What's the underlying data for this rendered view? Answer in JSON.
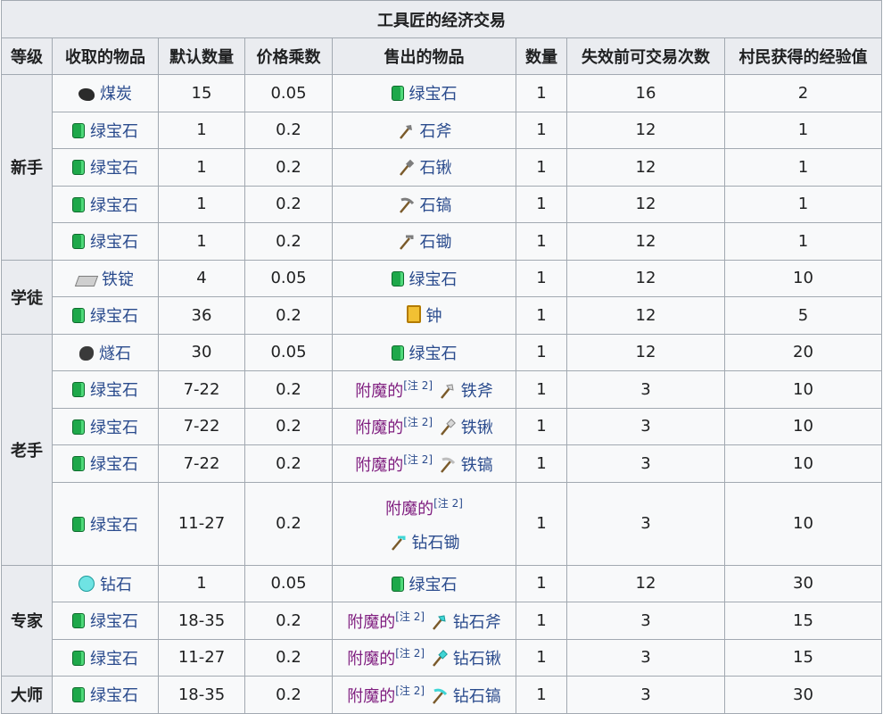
{
  "title": "工具匠的经济交易",
  "headers": [
    "等级",
    "收取的物品",
    "默认数量",
    "价格乘数",
    "售出的物品",
    "数量",
    "失效前可交易次数",
    "村民获得的经验值"
  ],
  "levels": [
    "新手",
    "学徒",
    "老手",
    "专家",
    "大师"
  ],
  "ench_label": "附魔的",
  "note": "[注 2]",
  "rows": [
    {
      "buy": "煤炭",
      "qty": "15",
      "mult": "0.05",
      "sell": "绿宝石",
      "n": "1",
      "uses": "16",
      "xp": "2"
    },
    {
      "buy": "绿宝石",
      "qty": "1",
      "mult": "0.2",
      "sell": "石斧",
      "n": "1",
      "uses": "12",
      "xp": "1"
    },
    {
      "buy": "绿宝石",
      "qty": "1",
      "mult": "0.2",
      "sell": "石锹",
      "n": "1",
      "uses": "12",
      "xp": "1"
    },
    {
      "buy": "绿宝石",
      "qty": "1",
      "mult": "0.2",
      "sell": "石镐",
      "n": "1",
      "uses": "12",
      "xp": "1"
    },
    {
      "buy": "绿宝石",
      "qty": "1",
      "mult": "0.2",
      "sell": "石锄",
      "n": "1",
      "uses": "12",
      "xp": "1"
    },
    {
      "buy": "铁锭",
      "qty": "4",
      "mult": "0.05",
      "sell": "绿宝石",
      "n": "1",
      "uses": "12",
      "xp": "10"
    },
    {
      "buy": "绿宝石",
      "qty": "36",
      "mult": "0.2",
      "sell": "钟",
      "n": "1",
      "uses": "12",
      "xp": "5"
    },
    {
      "buy": "燧石",
      "qty": "30",
      "mult": "0.05",
      "sell": "绿宝石",
      "n": "1",
      "uses": "12",
      "xp": "20"
    },
    {
      "buy": "绿宝石",
      "qty": "7-22",
      "mult": "0.2",
      "sell": "铁斧",
      "n": "1",
      "uses": "3",
      "xp": "10"
    },
    {
      "buy": "绿宝石",
      "qty": "7-22",
      "mult": "0.2",
      "sell": "铁锹",
      "n": "1",
      "uses": "3",
      "xp": "10"
    },
    {
      "buy": "绿宝石",
      "qty": "7-22",
      "mult": "0.2",
      "sell": "铁镐",
      "n": "1",
      "uses": "3",
      "xp": "10"
    },
    {
      "buy": "绿宝石",
      "qty": "11-27",
      "mult": "0.2",
      "sell": "钻石锄",
      "n": "1",
      "uses": "3",
      "xp": "10"
    },
    {
      "buy": "钻石",
      "qty": "1",
      "mult": "0.05",
      "sell": "绿宝石",
      "n": "1",
      "uses": "12",
      "xp": "30"
    },
    {
      "buy": "绿宝石",
      "qty": "18-35",
      "mult": "0.2",
      "sell": "钻石斧",
      "n": "1",
      "uses": "3",
      "xp": "15"
    },
    {
      "buy": "绿宝石",
      "qty": "11-27",
      "mult": "0.2",
      "sell": "钻石锹",
      "n": "1",
      "uses": "3",
      "xp": "15"
    },
    {
      "buy": "绿宝石",
      "qty": "18-35",
      "mult": "0.2",
      "sell": "钻石镐",
      "n": "1",
      "uses": "3",
      "xp": "30"
    }
  ],
  "icons": {
    "emerald": "emerald-icon",
    "coal": "coal-icon",
    "iron_ingot": "iron-ingot-icon",
    "flint": "flint-icon",
    "diamond": "diamond-icon",
    "bell": "bell-icon",
    "tool": "tool-icon"
  }
}
